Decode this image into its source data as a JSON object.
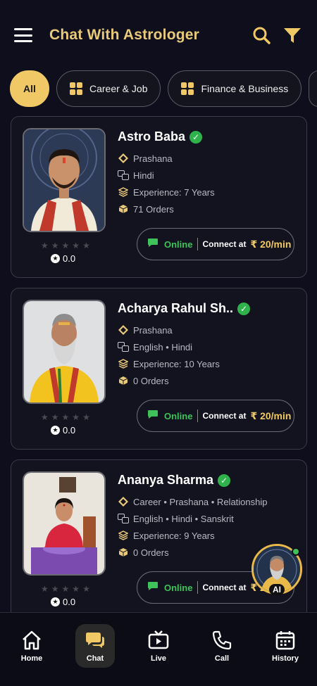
{
  "header": {
    "title": "Chat With Astrologer"
  },
  "filters": [
    {
      "label": "All",
      "active": true
    },
    {
      "label": "Career & Job"
    },
    {
      "label": "Finance & Business"
    }
  ],
  "astrologers": [
    {
      "name": "Astro Baba",
      "skills": "Prashana",
      "languages": "Hindi",
      "experience": "Experience: 7 Years",
      "orders": "71 Orders",
      "rating": "0.0",
      "status": "Online",
      "connect_label": "Connect at",
      "price": "₹ 20/min"
    },
    {
      "name": "Acharya Rahul Sh..",
      "skills": "Prashana",
      "languages": "English • Hindi",
      "experience": "Experience: 10 Years",
      "orders": "0 Orders",
      "rating": "0.0",
      "status": "Online",
      "connect_label": "Connect at",
      "price": "₹ 20/min"
    },
    {
      "name": "Ananya Sharma",
      "skills": "Career • Prashana • Relationship",
      "languages": "English • Hindi • Sanskrit",
      "experience": "Experience: 9 Years",
      "orders": "0 Orders",
      "rating": "0.0",
      "status": "Online",
      "connect_label": "Connect at",
      "price": "₹ 2"
    }
  ],
  "ai_fab": {
    "label": "AI"
  },
  "bottom_nav": [
    {
      "label": "Home",
      "icon": "home-icon"
    },
    {
      "label": "Chat",
      "icon": "chat-icon",
      "active": true
    },
    {
      "label": "Live",
      "icon": "tv-icon"
    },
    {
      "label": "Call",
      "icon": "phone-icon"
    },
    {
      "label": "History",
      "icon": "calendar-icon"
    }
  ],
  "colors": {
    "accent": "#f0c865",
    "online": "#3fc25a",
    "background": "#0e0e1c",
    "verified": "#2fb24b"
  }
}
